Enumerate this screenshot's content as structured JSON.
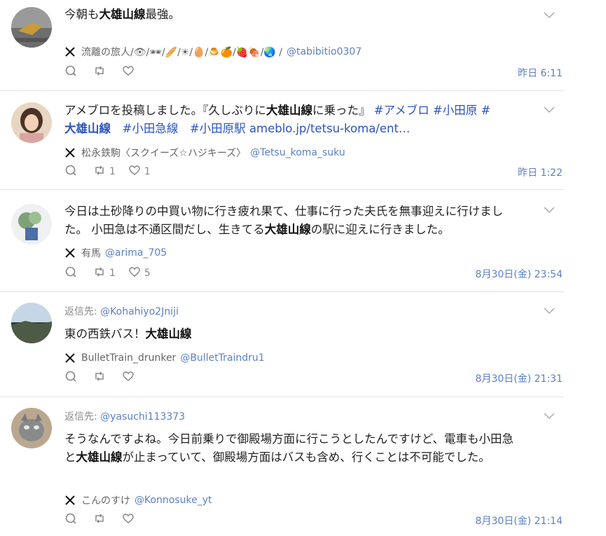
{
  "posts": [
    {
      "reply_to": "",
      "text": [
        {
          "t": "今朝も"
        },
        {
          "t": "大雄山線",
          "b": true
        },
        {
          "t": "最強。"
        }
      ],
      "author_name": "流離の旅人/👁/🕶/🥖/☀/🥚/🍮🍊/🍓🍖/🌏 /",
      "handle": "@tabibitio0307",
      "reply_count": "",
      "retweet_count": "",
      "like_count": "",
      "time": "昨日 6:11"
    },
    {
      "reply_to": "",
      "text": [
        {
          "t": "アメブロを投稿しました。『久しぶりに"
        },
        {
          "t": "大雄山線",
          "b": true
        },
        {
          "t": "に乗った』 "
        },
        {
          "t": "#アメブロ #小田原 #",
          "tag": true
        },
        {
          "br": true
        },
        {
          "t": "大雄山線",
          "tag": true,
          "b": true
        },
        {
          "t": "　#小田急線　#小田原駅 ameblo.jp/tetsu-koma/ent…",
          "tag": true
        }
      ],
      "author_name": "松永鉄駒〈スクイーズ☆ハジキーズ〉",
      "handle": "@Tetsu_koma_suku",
      "reply_count": "",
      "retweet_count": "1",
      "like_count": "1",
      "time": "昨日 1:22"
    },
    {
      "reply_to": "",
      "text": [
        {
          "t": "今日は土砂降りの中買い物に行き疲れ果て、仕事に行った夫氏を無事迎えに行けました。 小田急は不通区間だし、生きてる"
        },
        {
          "t": "大雄山線",
          "b": true
        },
        {
          "t": "の駅に迎えに行きました。"
        }
      ],
      "author_name": "有馬",
      "handle": "@arima_705",
      "reply_count": "",
      "retweet_count": "1",
      "like_count": "5",
      "time": "8月30日(金) 23:54"
    },
    {
      "reply_to_label": "返信先:",
      "reply_to": "@Kohahiyo2Jniji",
      "text": [
        {
          "t": "東の西鉄バス！"
        },
        {
          "t": "大雄山線",
          "b": true
        }
      ],
      "author_name": "BulletTrain_drunker",
      "handle": "@BulletTraindru1",
      "reply_count": "",
      "retweet_count": "",
      "like_count": "",
      "time": "8月30日(金) 21:31"
    },
    {
      "reply_to_label": "返信先:",
      "reply_to": "@yasuchi113373",
      "text": [
        {
          "t": "そうなんですよね。今日前乗りで御殿場方面に行こうとしたんですけど、電車も小田急と"
        },
        {
          "t": "大雄山線",
          "b": true
        },
        {
          "t": "が止まっていて、御殿場方面はバスも含め、行くことは不可能でした。"
        }
      ],
      "author_name": "こんのすけ",
      "handle": "@Konnosuke_yt",
      "reply_count": "",
      "retweet_count": "",
      "like_count": "",
      "time": "8月30日(金) 21:14"
    }
  ],
  "icons": {
    "x_logo": "x-logo-icon",
    "reply": "reply-icon",
    "retweet": "retweet-icon",
    "like": "heart-icon",
    "menu": "chevron-down-icon"
  },
  "colors": {
    "link": "#2b53c2",
    "handle": "#5b7fc4",
    "divider": "#e3e3e3"
  }
}
